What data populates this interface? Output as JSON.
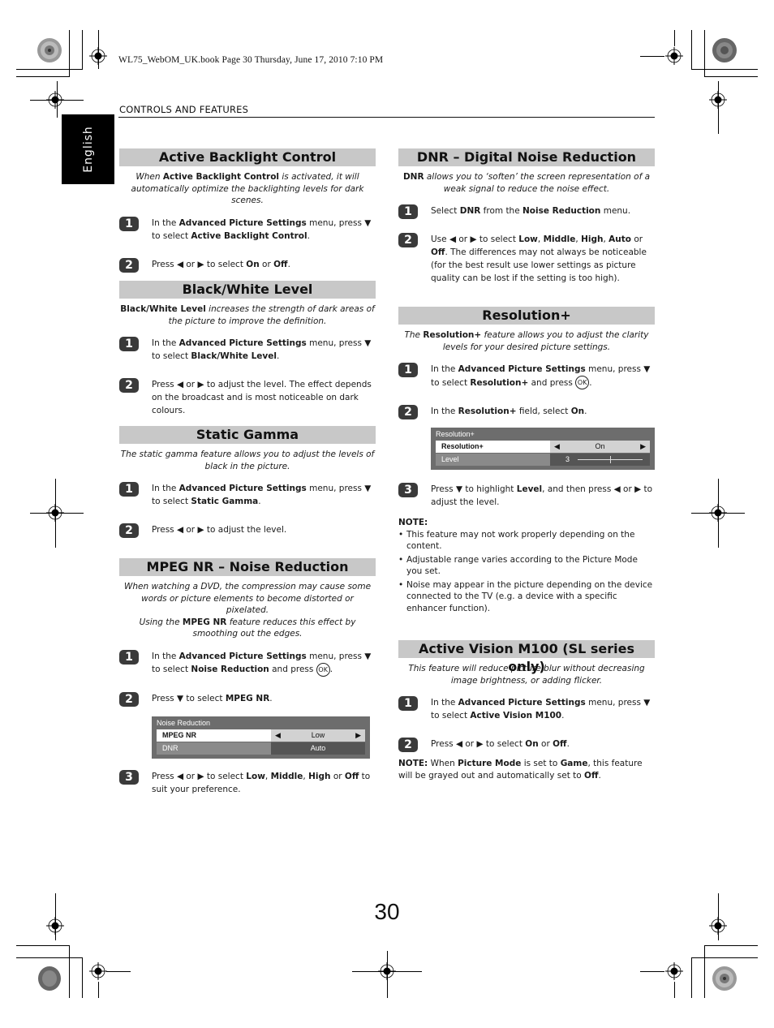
{
  "print_info": "WL75_WebOM_UK.book  Page 30  Thursday, June 17, 2010  7:10 PM",
  "running_head": "CONTROLS AND FEATURES",
  "language_tab": "English",
  "page_number": "30",
  "sections": {
    "backlight": {
      "title": "Active Backlight Control",
      "intro_pre": "When ",
      "intro_bold": "Active Backlight Control",
      "intro_post": " is activated, it will automatically optimize the backlighting levels for dark scenes.",
      "steps": [
        {
          "num": "1",
          "html": "In the <b>Advanced Picture Settings</b> menu, press ▼ to select <b>Active Backlight Control</b>."
        },
        {
          "num": "2",
          "html": "Press ◀ or ▶ to select <b>On</b> or <b>Off</b>."
        }
      ]
    },
    "bwlevel": {
      "title": "Black/White Level",
      "intro_pre": "",
      "intro_bold": "Black/White Level",
      "intro_post": " increases the strength of dark areas of the picture to improve the definition.",
      "steps": [
        {
          "num": "1",
          "html": "In the <b>Advanced Picture Settings</b> menu, press ▼ to select <b>Black/White Level</b>."
        },
        {
          "num": "2",
          "html": "Press ◀ or ▶ to adjust the level. The effect depends on the broadcast and is most noticeable on dark colours."
        }
      ]
    },
    "gamma": {
      "title": "Static Gamma",
      "intro": "The static gamma feature allows you to adjust the levels of black in the picture.",
      "steps": [
        {
          "num": "1",
          "html": "In the <b>Advanced Picture Settings</b> menu, press ▼ to select <b>Static Gamma</b>."
        },
        {
          "num": "2",
          "html": "Press ◀ or ▶ to adjust the level."
        }
      ]
    },
    "mpeg": {
      "title": "MPEG NR – Noise Reduction",
      "intro_line1": "When watching a DVD, the compression may cause some words or picture elements to become distorted or pixelated.",
      "intro_pre": "Using the ",
      "intro_bold": "MPEG NR",
      "intro_post": " feature reduces this effect by smoothing out the edges.",
      "steps": [
        {
          "num": "1",
          "html": "In the <b>Advanced Picture Settings</b> menu, press ▼ to select <b>Noise Reduction</b> and press <span class=\"okc\">OK</span>."
        },
        {
          "num": "2",
          "html": "Press ▼ to select <b>MPEG NR</b>."
        },
        {
          "num": "3",
          "html": "Press ◀ or ▶ to select <b>Low</b>, <b>Middle</b>, <b>High</b> or <b>Off</b> to suit your preference."
        }
      ],
      "osd": {
        "title": "Noise Reduction",
        "rows": [
          {
            "label": "MPEG NR",
            "value": "Low",
            "selected": true
          },
          {
            "label": "DNR",
            "value": "Auto",
            "selected": false
          }
        ]
      }
    },
    "dnr": {
      "title": "DNR – Digital Noise Reduction",
      "intro_bold": "DNR",
      "intro_post": " allows you to ‘soften’ the screen representation of a weak signal to reduce the noise effect.",
      "steps": [
        {
          "num": "1",
          "html": "Select <b>DNR</b> from the <b>Noise Reduction</b> menu."
        },
        {
          "num": "2",
          "html": "Use ◀ or ▶ to select <b>Low</b>, <b>Middle</b>, <b>High</b>, <b>Auto</b> or <b>Off</b>. The differences may not always be noticeable (for the best result use lower settings as picture quality can be lost if the setting is too high)."
        }
      ]
    },
    "resolution": {
      "title": "Resolution+",
      "intro_pre": "The ",
      "intro_bold": "Resolution+",
      "intro_post": " feature allows you to adjust the clarity levels for your desired picture settings.",
      "steps": [
        {
          "num": "1",
          "html": "In the <b>Advanced Picture Settings</b> menu, press ▼ to select <b>Resolution+</b> and press <span class=\"okc\">OK</span>."
        },
        {
          "num": "2",
          "html": "In the <b>Resolution+</b> field, select <b>On</b>."
        },
        {
          "num": "3",
          "html": "Press ▼ to highlight <b>Level</b>, and then press ◀ or ▶ to adjust the level."
        }
      ],
      "osd": {
        "title": "Resolution+",
        "rows": [
          {
            "label": "Resolution+",
            "value": "On",
            "selected": true
          },
          {
            "label": "Level",
            "value": "3",
            "selected": false,
            "slider_fraction": 0.5
          }
        ]
      },
      "note_label": "NOTE:",
      "notes": [
        "This feature may not work properly depending on the content.",
        "Adjustable range varies according to the Picture Mode you set.",
        "Noise may appear in the picture depending on the device connected to the TV (e.g. a device with a specific enhancer function)."
      ]
    },
    "activevision": {
      "title": "Active Vision M100 (SL series only)",
      "intro": "This feature will reduce picture blur without decreasing image brightness, or adding flicker.",
      "steps": [
        {
          "num": "1",
          "html": "In the <b>Advanced Picture Settings</b> menu, press ▼ to select <b>Active Vision M100</b>."
        },
        {
          "num": "2",
          "html": "Press ◀ or ▶ to select <b>On</b> or <b>Off</b>."
        }
      ],
      "note_html": "<b>NOTE:</b> When <b>Picture Mode</b> is set to <b>Game</b>, this feature will be grayed out and automatically set to <b>Off</b>."
    }
  }
}
